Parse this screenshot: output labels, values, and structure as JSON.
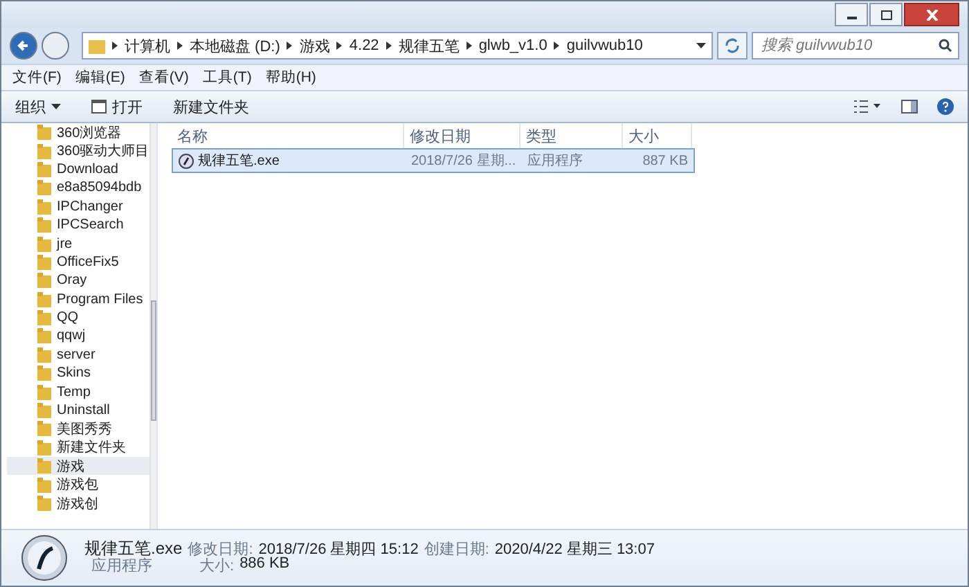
{
  "address_bar": {
    "crumbs": [
      "计算机",
      "本地磁盘 (D:)",
      "游戏",
      "4.22",
      "规律五笔",
      "glwb_v1.0",
      "guilvwub10"
    ]
  },
  "search": {
    "placeholder": "搜索 guilvwub10"
  },
  "menu": [
    "文件(F)",
    "编辑(E)",
    "查看(V)",
    "工具(T)",
    "帮助(H)"
  ],
  "toolbar": {
    "organize": "组织",
    "open": "打开",
    "new_folder": "新建文件夹"
  },
  "sidebar": {
    "items": [
      {
        "label": "360浏览器",
        "selected": false
      },
      {
        "label": "360驱动大师目",
        "selected": false
      },
      {
        "label": "Download",
        "selected": false
      },
      {
        "label": "e8a85094bdb",
        "selected": false
      },
      {
        "label": "IPChanger",
        "selected": false
      },
      {
        "label": "IPCSearch",
        "selected": false
      },
      {
        "label": "jre",
        "selected": false
      },
      {
        "label": "OfficeFix5",
        "selected": false
      },
      {
        "label": "Oray",
        "selected": false
      },
      {
        "label": "Program Files",
        "selected": false
      },
      {
        "label": "QQ",
        "selected": false
      },
      {
        "label": "qqwj",
        "selected": false
      },
      {
        "label": "server",
        "selected": false
      },
      {
        "label": "Skins",
        "selected": false
      },
      {
        "label": "Temp",
        "selected": false
      },
      {
        "label": "Uninstall",
        "selected": false
      },
      {
        "label": "美图秀秀",
        "selected": false
      },
      {
        "label": "新建文件夹",
        "selected": false
      },
      {
        "label": "游戏",
        "selected": true
      },
      {
        "label": "游戏包",
        "selected": false
      },
      {
        "label": "游戏创",
        "selected": false
      }
    ]
  },
  "table": {
    "columns": [
      "名称",
      "修改日期",
      "类型",
      "大小"
    ],
    "rows": [
      {
        "name": "规律五笔.exe",
        "date": "2018/7/26 星期...",
        "type": "应用程序",
        "size": "887 KB",
        "selected": true
      }
    ]
  },
  "details": {
    "name": "规律五笔.exe",
    "modified_label": "修改日期:",
    "modified": "2018/7/26 星期四 15:12",
    "created_label": "创建日期:",
    "created": "2020/4/22 星期三 13:07",
    "type": "应用程序",
    "size_label": "大小:",
    "size": "886 KB"
  }
}
